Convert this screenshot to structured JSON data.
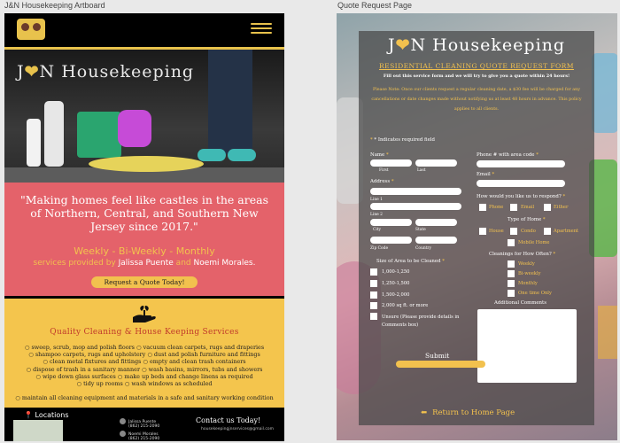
{
  "artboards": {
    "left_label": "J&N Housekeeping Artboard",
    "right_label": "Quote Request Page"
  },
  "brand": {
    "name_pre": "J",
    "name_mid": "N",
    "name_post": " Housekeeping",
    "accent": "#f2c14e",
    "coral": "#e4626a"
  },
  "left": {
    "hero_title_pre": "J",
    "hero_title_mid": "N",
    "hero_title_post": " Housekeeping",
    "quote": "\"Making homes feel like castles in the areas of Northern, Central, and Southern New Jersey since 2017.\"",
    "frequency": "Weekly - Bi-Weekly - Monthly",
    "byline_pre": "services provided by ",
    "byline_name1": "Jalissa Puente",
    "byline_and": " and ",
    "byline_name2": "Noemi Morales.",
    "request_button": "Request a Quote Today!",
    "services_title": "Quality Cleaning & House Keeping Services",
    "services": [
      "○ sweep, scrub, mop and polish floors   ○ vacuum clean carpets, rugs and draperies",
      "○ shampoo carpets, rugs and upholstery   ○ dust and polish furniture and fittings",
      "○ clean metal fixtures and fittings   ○ empty and clean trash containers",
      "○ dispose of trash in a sanitary manner   ○ wash basins, mirrors, tubs and showers",
      "○ wipe down glass surfaces   ○ make up beds and change linens as required",
      "○ tidy up rooms   ○ wash windows as scheduled",
      "",
      "○ maintain all cleaning equipment and materials in a safe and sanitary working condition"
    ],
    "locations": "Locations",
    "contact": "Contact us Today!",
    "person1_name": "Jalissa Puente",
    "person1_phone": "(862) 215-2090",
    "person2_name": "Noemi Morales",
    "person2_phone": "(862) 215-2090",
    "email": "housekeepingjnservices@gmail.com"
  },
  "right": {
    "title_pre": "J",
    "title_mid": "N",
    "title_post": " Housekeeping",
    "subtitle": "RESIDENTIAL CLEANING QUOTE REQUEST FORM",
    "intro": "Fill out this service form and we will try to give you a quote within 24 hours!",
    "note": "Please Note: Once our clients request a regular cleaning date, a $30 fee will be charged for any cancellations or date changes made without notifying us at least 48 hours in advance. This policy applies to all clients.",
    "required_note": "* Indicates required field",
    "name_label": "Name",
    "first": "First",
    "last": "Last",
    "address_label": "Address",
    "line1": "Line 1",
    "line2": "Line 2",
    "city": "City",
    "state": "State",
    "zip": "Zip Code",
    "country": "Country",
    "size_label": "Size of Area to be Cleaned",
    "sizes": [
      "1,000-1,250",
      "1,250-1,500",
      "1,500-2,000",
      "2,000 sq ft. or more",
      "Unsure (Please provide details in Comments box)"
    ],
    "phone_label": "Phone # with area code",
    "email_label": "Email",
    "respond_label": "How would you like us to respond?",
    "respond_options": [
      "Phone",
      "Email",
      "Either"
    ],
    "home_label": "Type of Home",
    "home_options": [
      "House",
      "Condo",
      "Apartment",
      "Mobile Home"
    ],
    "often_label": "Cleanings for How Often?",
    "often_options": [
      "Weekly",
      "Bi-weekly",
      "Monthly",
      "One time Only"
    ],
    "comments_label": "Additional Comments",
    "submit": "Submit",
    "return": "Return to Home Page"
  }
}
